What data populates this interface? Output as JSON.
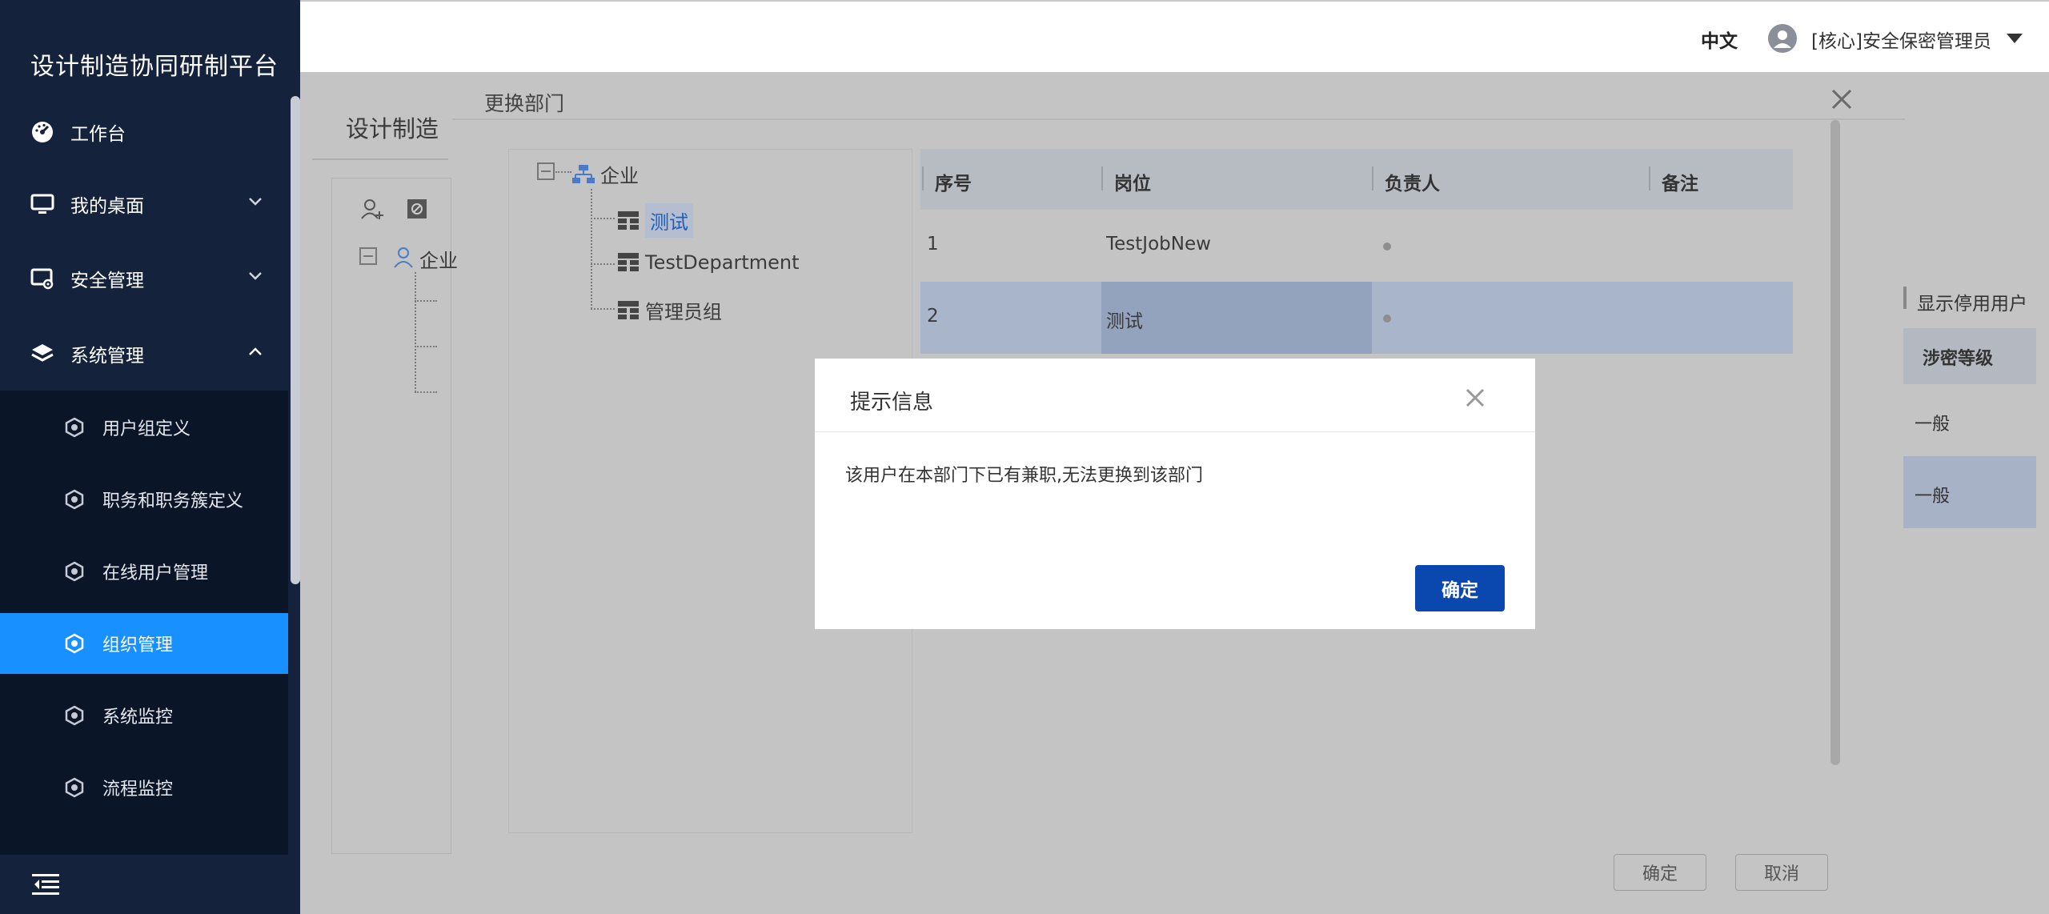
{
  "sidebar": {
    "brand": "设计制造协同研制平台",
    "menu": [
      {
        "label": "工作台",
        "icon": "dashboard-icon"
      },
      {
        "label": "我的桌面",
        "icon": "monitor-icon"
      },
      {
        "label": "安全管理",
        "icon": "security-icon"
      },
      {
        "label": "系统管理",
        "icon": "layers-icon"
      }
    ],
    "submenu": [
      {
        "label": "用户组定义"
      },
      {
        "label": "职务和职务簇定义"
      },
      {
        "label": "在线用户管理"
      },
      {
        "label": "组织管理",
        "active": true
      },
      {
        "label": "系统监控"
      },
      {
        "label": "流程监控"
      }
    ],
    "active_color": "#1890ff"
  },
  "header": {
    "language": "中文",
    "user": "[核心]安全保密管理员"
  },
  "background_page": {
    "title": "设计制造",
    "tree_root": "企业",
    "show_disabled_label": "显示停用用户",
    "secret_level_header": "涉密等级",
    "secret_levels": [
      "一般",
      "一般"
    ]
  },
  "dept_dialog": {
    "title": "更换部门",
    "tree": {
      "root": "企业",
      "children": [
        "测试",
        "TestDepartment",
        "管理员组"
      ]
    },
    "grid": {
      "headers": [
        "序号",
        "岗位",
        "负责人",
        "备注"
      ],
      "rows": [
        {
          "index": "1",
          "position": "TestJobNew",
          "owner": "",
          "note": ""
        },
        {
          "index": "2",
          "position": "测试",
          "owner": "",
          "note": ""
        }
      ]
    },
    "confirm_label": "确定",
    "cancel_label": "取消"
  },
  "alert": {
    "title": "提示信息",
    "message": "该用户在本部门下已有兼职,无法更换到该部门",
    "ok_label": "确定",
    "ok_color": "#0a48b0"
  }
}
